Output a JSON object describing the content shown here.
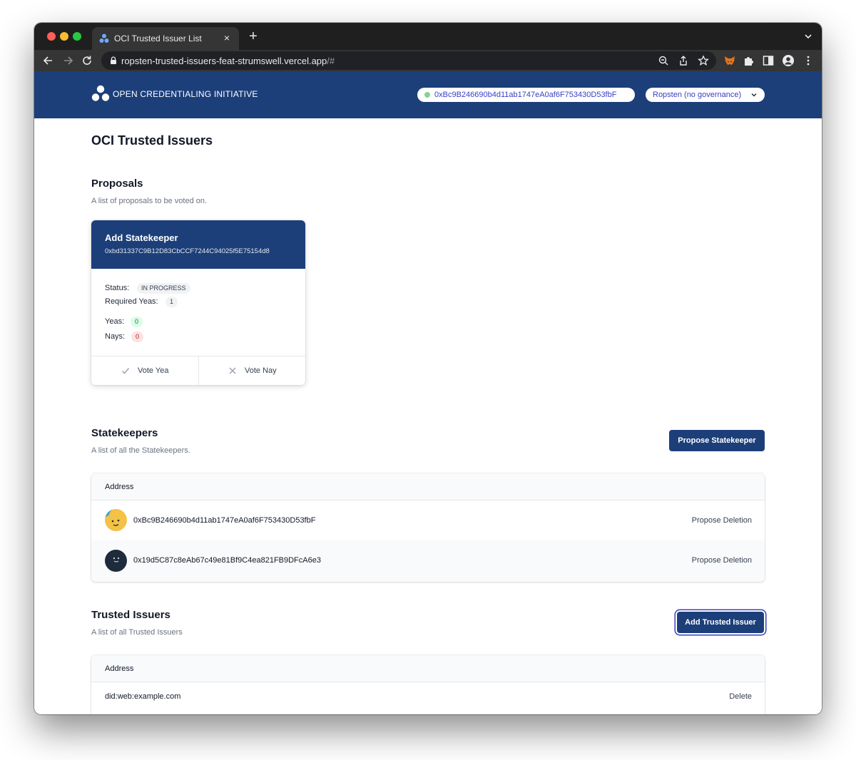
{
  "browser": {
    "tab_title": "OCI Trusted Issuer List",
    "tab_close": "×",
    "new_tab": "+",
    "url_main": "ropsten-trusted-issuers-feat-strumswell.vercel.app",
    "url_rest": "/#"
  },
  "header": {
    "logo_text": "OPEN CREDENTIALING INITIATIVE",
    "account_address": "0xBc9B246690b4d11ab1747eA0af6F753430D53fbF",
    "network": "Ropsten (no governance)"
  },
  "page": {
    "title": "OCI Trusted Issuers"
  },
  "proposals": {
    "title": "Proposals",
    "subtitle": "A list of proposals to be voted on.",
    "items": [
      {
        "title": "Add Statekeeper",
        "address": "0xbd31337C9B12D83CbCCF7244C94025f5E75154d8",
        "status_label": "Status:",
        "status": "IN PROGRESS",
        "required_label": "Required Yeas:",
        "required": "1",
        "yeas_label": "Yeas:",
        "yeas": "0",
        "nays_label": "Nays:",
        "nays": "0",
        "vote_yea": "Vote Yea",
        "vote_nay": "Vote Nay"
      }
    ]
  },
  "statekeepers": {
    "title": "Statekeepers",
    "subtitle": "A list of all the Statekeepers.",
    "button": "Propose Statekeeper",
    "column": "Address",
    "rows": [
      {
        "address": "0xBc9B246690b4d11ab1747eA0af6F753430D53fbF",
        "action": "Propose Deletion"
      },
      {
        "address": "0x19d5C87c8eAb67c49e81Bf9C4ea821FB9DFcA6e3",
        "action": "Propose Deletion"
      }
    ]
  },
  "trusted_issuers": {
    "title": "Trusted Issuers",
    "subtitle": "A list of all Trusted Issuers",
    "button": "Add Trusted Issuer",
    "column": "Address",
    "rows": [
      {
        "address": "did:web:example.com",
        "action": "Delete"
      }
    ]
  },
  "colors": {
    "brand": "#1c3f7a",
    "accent": "#3b3ec2",
    "online": "#86d19a"
  }
}
